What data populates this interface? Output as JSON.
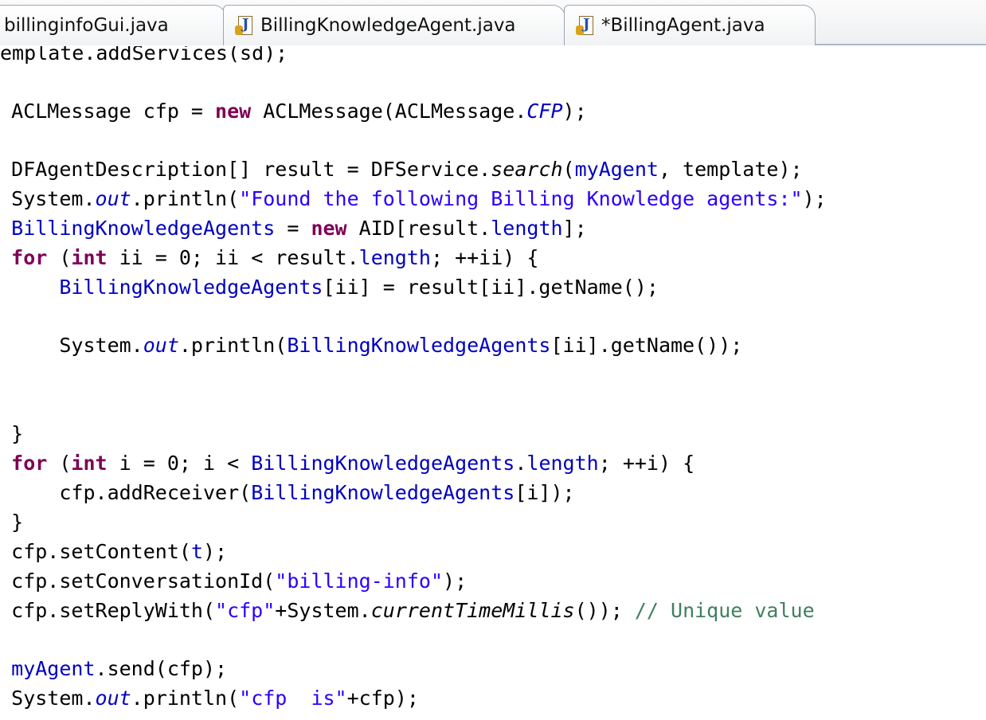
{
  "tabs": [
    {
      "label": "billinginfoGui.java",
      "icon": "java-file-icon"
    },
    {
      "label": "BillingKnowledgeAgent.java",
      "icon": "java-file-icon"
    },
    {
      "label": "*BillingAgent.java",
      "icon": "java-file-icon"
    }
  ],
  "code_lines": [
    [
      {
        "t": "emplate.addServices(sd);",
        "c": "plain"
      }
    ],
    [
      {
        "t": "   ACLMessage cfp = ",
        "c": "plain"
      },
      {
        "t": "new",
        "c": "kw"
      },
      {
        "t": " ACLMessage(ACLMessage.",
        "c": "plain"
      },
      {
        "t": "CFP",
        "c": "sfld"
      },
      {
        "t": ");",
        "c": "plain"
      }
    ],
    [
      {
        "t": "   DFAgentDescription[] result = DFService.",
        "c": "plain"
      },
      {
        "t": "search",
        "c": "sm"
      },
      {
        "t": "(",
        "c": "plain"
      },
      {
        "t": "myAgent",
        "c": "fld"
      },
      {
        "t": ", template);",
        "c": "plain"
      }
    ],
    [
      {
        "t": "   System.",
        "c": "plain"
      },
      {
        "t": "out",
        "c": "sfld"
      },
      {
        "t": ".println(",
        "c": "plain"
      },
      {
        "t": "\"Found the following Billing Knowledge agents:\"",
        "c": "str"
      },
      {
        "t": ");",
        "c": "plain"
      }
    ],
    [
      {
        "t": "   ",
        "c": "plain"
      },
      {
        "t": "BillingKnowledgeAgents",
        "c": "fld"
      },
      {
        "t": " = ",
        "c": "plain"
      },
      {
        "t": "new",
        "c": "kw"
      },
      {
        "t": " AID[result.",
        "c": "plain"
      },
      {
        "t": "length",
        "c": "fld"
      },
      {
        "t": "];",
        "c": "plain"
      }
    ],
    [
      {
        "t": "   ",
        "c": "plain"
      },
      {
        "t": "for",
        "c": "kw"
      },
      {
        "t": " (",
        "c": "plain"
      },
      {
        "t": "int",
        "c": "kw"
      },
      {
        "t": " ii = 0; ii < result.",
        "c": "plain"
      },
      {
        "t": "length",
        "c": "fld"
      },
      {
        "t": "; ++ii) {",
        "c": "plain"
      }
    ],
    [
      {
        "t": "       ",
        "c": "plain"
      },
      {
        "t": "BillingKnowledgeAgents",
        "c": "fld"
      },
      {
        "t": "[ii] = result[ii].getName();",
        "c": "plain"
      }
    ],
    [
      {
        "t": "       System.",
        "c": "plain"
      },
      {
        "t": "out",
        "c": "sfld"
      },
      {
        "t": ".println(",
        "c": "plain"
      },
      {
        "t": "BillingKnowledgeAgents",
        "c": "fld"
      },
      {
        "t": "[ii].getName());",
        "c": "plain"
      }
    ],
    [
      {
        "t": "   }",
        "c": "plain"
      }
    ],
    [
      {
        "t": "   ",
        "c": "plain"
      },
      {
        "t": "for",
        "c": "kw"
      },
      {
        "t": " (",
        "c": "plain"
      },
      {
        "t": "int",
        "c": "kw"
      },
      {
        "t": " i = 0; i < ",
        "c": "plain"
      },
      {
        "t": "BillingKnowledgeAgents",
        "c": "fld"
      },
      {
        "t": ".",
        "c": "plain"
      },
      {
        "t": "length",
        "c": "fld"
      },
      {
        "t": "; ++i) {",
        "c": "plain"
      }
    ],
    [
      {
        "t": "       cfp.addReceiver(",
        "c": "plain"
      },
      {
        "t": "BillingKnowledgeAgents",
        "c": "fld"
      },
      {
        "t": "[i]);",
        "c": "plain"
      }
    ],
    [
      {
        "t": "   }",
        "c": "plain"
      }
    ],
    [
      {
        "t": "   cfp.setContent(",
        "c": "plain"
      },
      {
        "t": "t",
        "c": "fld"
      },
      {
        "t": ");",
        "c": "plain"
      }
    ],
    [
      {
        "t": "   cfp.setConversationId(",
        "c": "plain"
      },
      {
        "t": "\"billing-info\"",
        "c": "str"
      },
      {
        "t": ");",
        "c": "plain"
      }
    ],
    [
      {
        "t": "   cfp.setReplyWith(",
        "c": "plain"
      },
      {
        "t": "\"cfp\"",
        "c": "str"
      },
      {
        "t": "+System.",
        "c": "plain"
      },
      {
        "t": "currentTimeMillis",
        "c": "sm"
      },
      {
        "t": "()); ",
        "c": "plain"
      },
      {
        "t": "// Unique value",
        "c": "cmt"
      }
    ],
    [
      {
        "t": "   ",
        "c": "plain"
      },
      {
        "t": "myAgent",
        "c": "fld"
      },
      {
        "t": ".send(cfp);",
        "c": "plain"
      }
    ],
    [
      {
        "t": "   System.",
        "c": "plain"
      },
      {
        "t": "out",
        "c": "sfld"
      },
      {
        "t": ".println(",
        "c": "plain"
      },
      {
        "t": "\"cfp  is\"",
        "c": "str"
      },
      {
        "t": "+cfp);",
        "c": "plain"
      }
    ]
  ],
  "colors": {
    "keyword": "#7f0055",
    "field": "#0000c0",
    "string": "#2a00ff",
    "comment": "#3f7f5f"
  }
}
